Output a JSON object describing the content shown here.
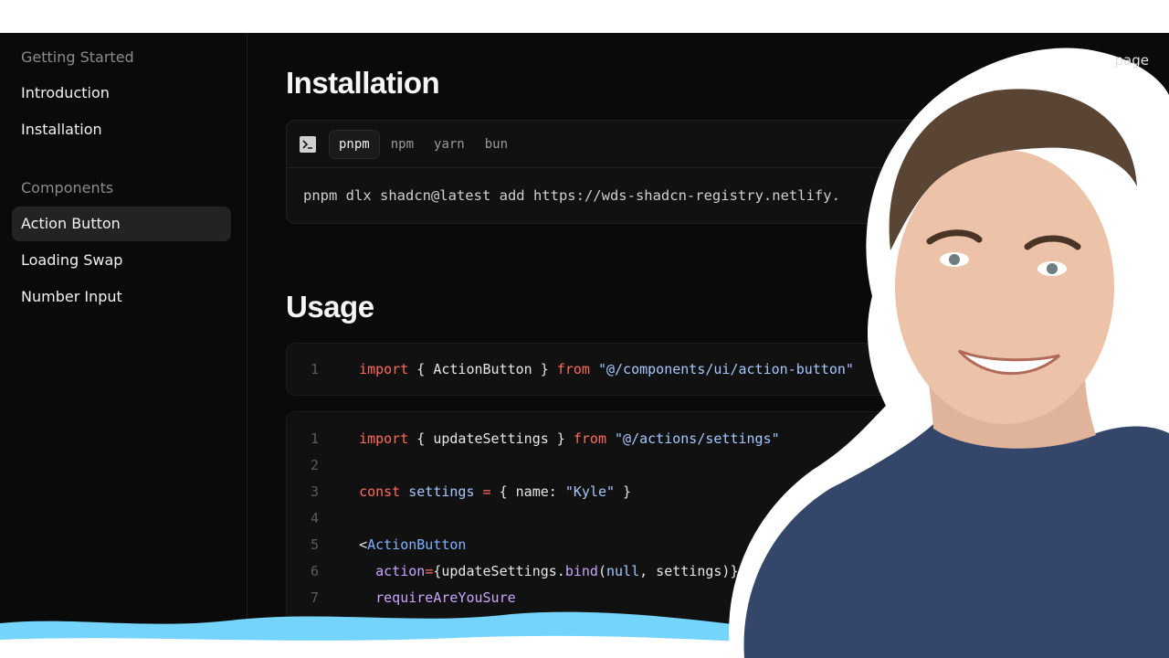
{
  "sidebar": {
    "groups": [
      {
        "title": "Getting Started",
        "items": [
          "Introduction",
          "Installation"
        ]
      },
      {
        "title": "Components",
        "items": [
          "Action Button",
          "Loading Swap",
          "Number Input"
        ]
      }
    ],
    "active_item": "Action Button"
  },
  "toc_hint": "page",
  "installation": {
    "heading": "Installation",
    "tabs": [
      "pnpm",
      "npm",
      "yarn",
      "bun"
    ],
    "active_tab": "pnpm",
    "command": "pnpm dlx shadcn@latest add https://wds-shadcn-registry.netlify."
  },
  "usage": {
    "heading": "Usage",
    "import_block": {
      "line_numbers": [
        "1"
      ],
      "lines": [
        [
          "import",
          " { ActionButton } ",
          "from",
          " \"@/components/ui/action-button\""
        ]
      ]
    },
    "example_block": {
      "line_numbers": [
        "1",
        "2",
        "3",
        "4",
        "5",
        "6",
        "7"
      ],
      "lines": [
        "import { updateSettings } from \"@/actions/settings\"",
        "",
        "const settings = { name: \"Kyle\" }",
        "",
        "<ActionButton",
        "  action={updateSettings.bind(null, settings)}",
        "  requireAreYouSure"
      ]
    }
  },
  "colors": {
    "background": "#0a0a0a",
    "card": "#111111",
    "keyword": "#ff6b5b",
    "string": "#a5c8ff",
    "brush": "#74d4fb"
  }
}
